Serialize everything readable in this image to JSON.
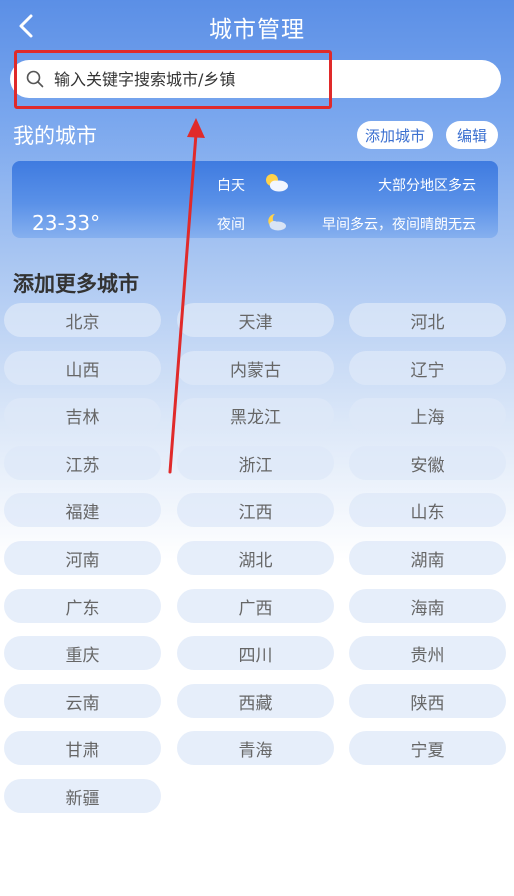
{
  "header": {
    "title": "城市管理",
    "back_icon": "chevron-left-icon"
  },
  "search": {
    "placeholder": "输入关键字搜索城市/乡镇",
    "value": "",
    "icon": "search-icon"
  },
  "my_cities": {
    "title": "我的城市",
    "add_label": "添加城市",
    "edit_label": "编辑",
    "card": {
      "temperature": "23-33°",
      "day_label": "白天",
      "day_desc": "大部分地区多云",
      "day_icon": "partly-cloudy-icon",
      "night_label": "夜间",
      "night_desc": "早间多云，夜间晴朗无云",
      "night_icon": "cloudy-night-icon"
    }
  },
  "more": {
    "title": "添加更多城市",
    "provinces": [
      "北京",
      "天津",
      "河北",
      "山西",
      "内蒙古",
      "辽宁",
      "吉林",
      "黑龙江",
      "上海",
      "江苏",
      "浙江",
      "安徽",
      "福建",
      "江西",
      "山东",
      "河南",
      "湖北",
      "湖南",
      "广东",
      "广西",
      "海南",
      "重庆",
      "四川",
      "贵州",
      "云南",
      "西藏",
      "陕西",
      "甘肃",
      "青海",
      "宁夏",
      "新疆"
    ]
  },
  "colors": {
    "highlight": "#e02a2a",
    "accent": "#3a6fd0"
  }
}
